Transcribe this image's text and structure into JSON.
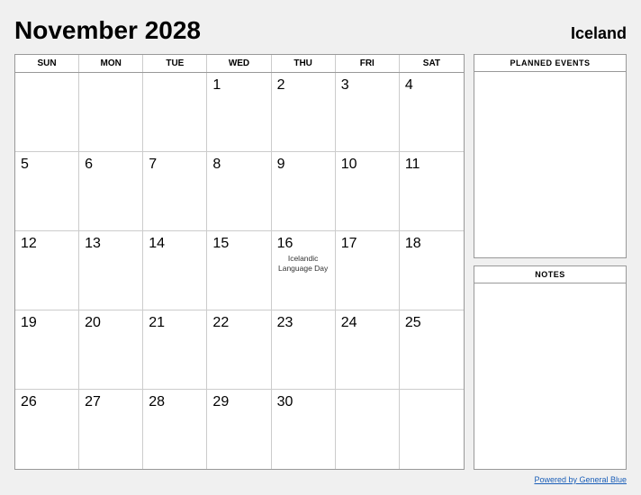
{
  "header": {
    "month_year": "November 2028",
    "country": "Iceland"
  },
  "day_headers": [
    "SUN",
    "MON",
    "TUE",
    "WED",
    "THU",
    "FRI",
    "SAT"
  ],
  "weeks": [
    [
      {
        "num": "",
        "empty": true
      },
      {
        "num": "",
        "empty": true
      },
      {
        "num": "",
        "empty": true
      },
      {
        "num": "1",
        "event": ""
      },
      {
        "num": "2",
        "event": ""
      },
      {
        "num": "3",
        "event": ""
      },
      {
        "num": "4",
        "event": ""
      }
    ],
    [
      {
        "num": "5",
        "event": ""
      },
      {
        "num": "6",
        "event": ""
      },
      {
        "num": "7",
        "event": ""
      },
      {
        "num": "8",
        "event": ""
      },
      {
        "num": "9",
        "event": ""
      },
      {
        "num": "10",
        "event": ""
      },
      {
        "num": "11",
        "event": ""
      }
    ],
    [
      {
        "num": "12",
        "event": ""
      },
      {
        "num": "13",
        "event": ""
      },
      {
        "num": "14",
        "event": ""
      },
      {
        "num": "15",
        "event": ""
      },
      {
        "num": "16",
        "event": "Icelandic\nLanguage Day"
      },
      {
        "num": "17",
        "event": ""
      },
      {
        "num": "18",
        "event": ""
      }
    ],
    [
      {
        "num": "19",
        "event": ""
      },
      {
        "num": "20",
        "event": ""
      },
      {
        "num": "21",
        "event": ""
      },
      {
        "num": "22",
        "event": ""
      },
      {
        "num": "23",
        "event": ""
      },
      {
        "num": "24",
        "event": ""
      },
      {
        "num": "25",
        "event": ""
      }
    ],
    [
      {
        "num": "26",
        "event": ""
      },
      {
        "num": "27",
        "event": ""
      },
      {
        "num": "28",
        "event": ""
      },
      {
        "num": "29",
        "event": ""
      },
      {
        "num": "30",
        "event": ""
      },
      {
        "num": "",
        "empty": true
      },
      {
        "num": "",
        "empty": true
      }
    ]
  ],
  "sidebar": {
    "planned_events_label": "PLANNED EVENTS",
    "notes_label": "NOTES"
  },
  "footer": {
    "link_text": "Powered by General Blue"
  }
}
